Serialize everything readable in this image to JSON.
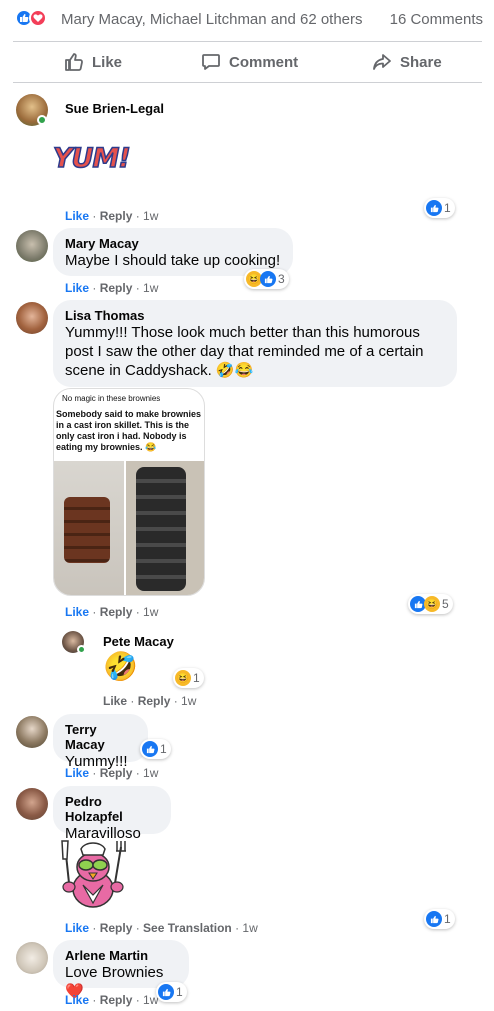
{
  "summary": {
    "reactors": "Mary Macay, Michael Litchman and 62 others",
    "comments_count": "16 Comments"
  },
  "actions": {
    "like": "Like",
    "comment": "Comment",
    "share": "Share"
  },
  "meta_labels": {
    "like": "Like",
    "reply": "Reply",
    "see_translation": "See Translation",
    "sep": " · "
  },
  "comments": [
    {
      "author": "Sue Brien-Legal",
      "sticker_text": "YUM!",
      "time": "1w",
      "reaction_count": "1"
    },
    {
      "author": "Mary Macay",
      "text": "Maybe I should take up cooking!",
      "time": "1w",
      "reaction_count": "3"
    },
    {
      "author": "Lisa Thomas",
      "text": "Yummy!!! Those look much better than this humorous post I saw the other day that reminded me of a certain scene in Caddyshack. 🤣😂",
      "meme_title": "No magic in these brownies",
      "meme_caption": "Somebody said to make brownies in a cast iron skillet. This is the only cast iron i had. Nobody is eating my brownies. 😂",
      "time": "1w",
      "reaction_count": "5"
    },
    {
      "author": "Pete Macay",
      "emoji": "🤣",
      "time": "1w",
      "reaction_count": "1"
    },
    {
      "author": "Terry Macay",
      "text": "Yummy!!!",
      "time": "1w",
      "reaction_count": "1"
    },
    {
      "author": "Pedro Holzapfel",
      "text": "Maravilloso",
      "time": "1w",
      "reaction_count": "1"
    },
    {
      "author": "Arlene Martin",
      "text": "Love Brownies❤️",
      "time": "1w",
      "reaction_count": "1"
    }
  ],
  "colors": {
    "like_blue": "#1877f2",
    "love_red": "#f33e58",
    "haha_yellow": "#f7b928",
    "bubble_bg": "#f0f2f5",
    "meta_gray": "#65676b"
  }
}
